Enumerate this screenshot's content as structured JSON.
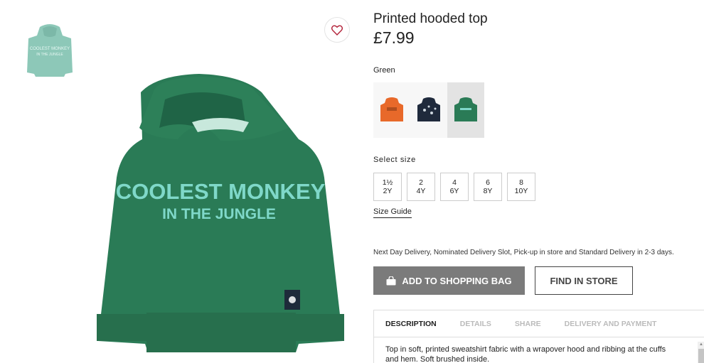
{
  "product": {
    "title": "Printed hooded top",
    "price": "£7.99",
    "print_line1": "COOLEST MONKEY",
    "print_line2": "IN THE JUNGLE",
    "thumb_line1": "COOLEST MONKEY",
    "thumb_line2": "IN THE JUNGLE"
  },
  "color": {
    "selected_label": "Green",
    "swatches": [
      {
        "name": "orange",
        "hex": "#e8692a"
      },
      {
        "name": "dark-blue",
        "hex": "#1f2a3c"
      },
      {
        "name": "green",
        "hex": "#2a7b56"
      }
    ]
  },
  "size": {
    "label": "Select size",
    "options": [
      {
        "line1": "1½",
        "line2": "2Y"
      },
      {
        "line1": "2",
        "line2": "4Y"
      },
      {
        "line1": "4",
        "line2": "6Y"
      },
      {
        "line1": "6",
        "line2": "8Y"
      },
      {
        "line1": "8",
        "line2": "10Y"
      }
    ],
    "guide": "Size Guide"
  },
  "delivery_text": "Next Day Delivery, Nominated Delivery Slot, Pick-up in store and Standard Delivery in 2-3 days.",
  "actions": {
    "add_to_bag": "ADD TO SHOPPING BAG",
    "find_in_store": "FIND IN STORE"
  },
  "tabs": [
    "DESCRIPTION",
    "DETAILS",
    "SHARE",
    "DELIVERY AND PAYMENT"
  ],
  "description": "Top in soft, printed sweatshirt fabric with a wrapover hood and ribbing at the cuffs and hem. Soft brushed inside.",
  "icons": {
    "favourite": "heart-icon",
    "bag": "bag-icon"
  },
  "colors": {
    "hoodie_green": "#2a7b56",
    "print_mint": "#7fd8c9",
    "button_grey": "#7b7b7b"
  }
}
